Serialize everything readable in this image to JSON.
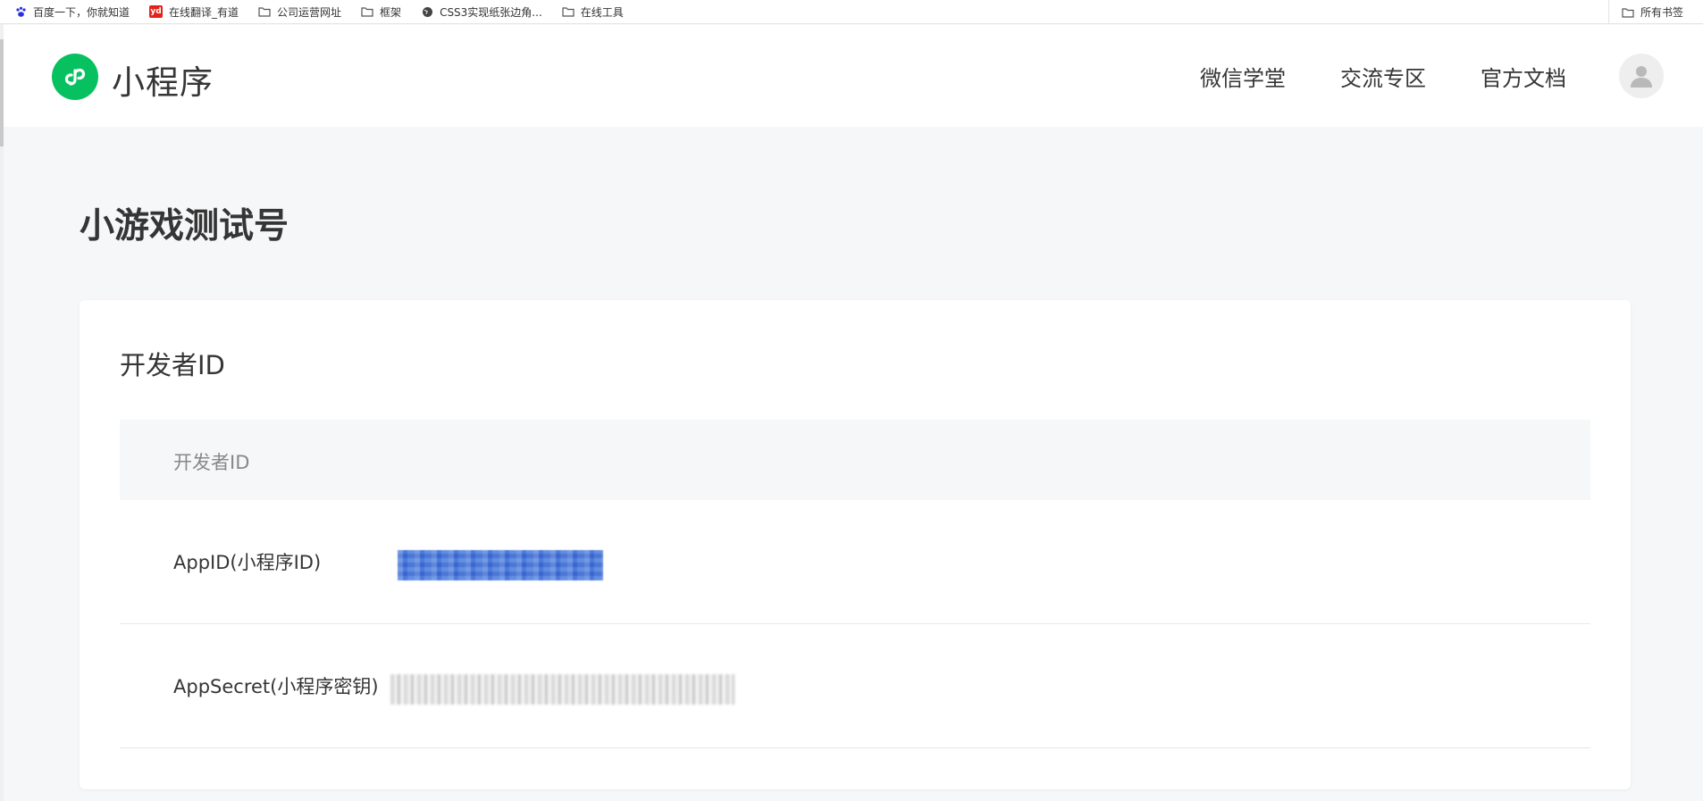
{
  "bookmarks": {
    "items": [
      {
        "label": "百度一下，你就知道",
        "icon": "baidu-paw-icon"
      },
      {
        "label": "在线翻译_有道",
        "icon": "youdao-icon",
        "badge": "yd"
      },
      {
        "label": "公司运营网址",
        "icon": "folder-icon"
      },
      {
        "label": "框架",
        "icon": "folder-icon"
      },
      {
        "label": "CSS3实现纸张边角...",
        "icon": "globe-icon"
      },
      {
        "label": "在线工具",
        "icon": "folder-icon"
      }
    ],
    "all_bookmarks": "所有书签"
  },
  "header": {
    "brand": "小程序",
    "logo_icon": "miniprogram-logo-icon",
    "nav": [
      "微信学堂",
      "交流专区",
      "官方文档"
    ],
    "avatar_icon": "user-avatar-icon"
  },
  "main": {
    "page_title": "小游戏测试号",
    "card": {
      "title": "开发者ID",
      "table_header": "开发者ID",
      "rows": [
        {
          "label": "AppID(小程序ID)",
          "value_state": "redacted-selected"
        },
        {
          "label": "AppSecret(小程序密钥)",
          "value_state": "redacted"
        }
      ]
    }
  },
  "colors": {
    "brand_green": "#07c160",
    "background": "#f6f7f9",
    "text": "#353535",
    "selection_blue": "#3f73dc"
  }
}
